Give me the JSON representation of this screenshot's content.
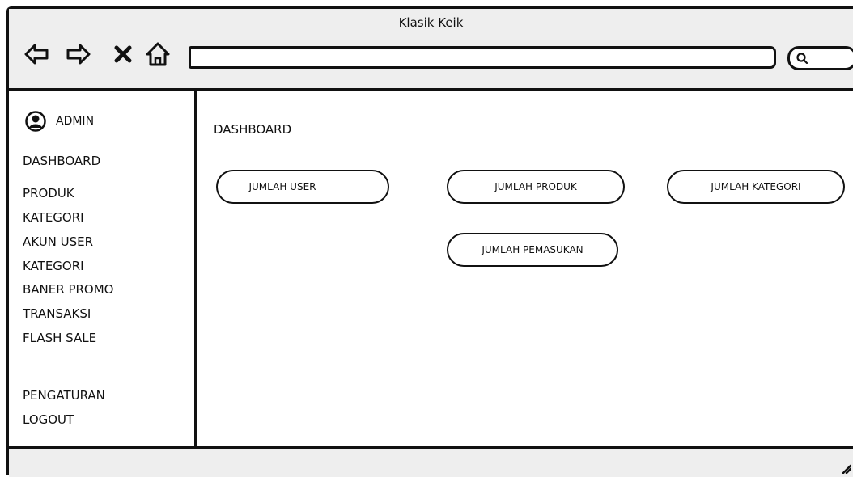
{
  "window": {
    "title": "Klasik Keik",
    "address_value": ""
  },
  "toolbar": {
    "icons": [
      "back-arrow-icon",
      "forward-arrow-icon",
      "close-x-icon",
      "home-icon",
      "search-icon"
    ]
  },
  "sidebar": {
    "admin_label": "ADMIN",
    "items": [
      {
        "label": "DASHBOARD"
      },
      {
        "label": "PRODUK"
      },
      {
        "label": "KATEGORI"
      },
      {
        "label": "AKUN USER"
      },
      {
        "label": "KATEGORI"
      },
      {
        "label": "BANER PROMO"
      },
      {
        "label": "TRANSAKSI"
      },
      {
        "label": "FLASH SALE"
      },
      {
        "label": "PENGATURAN"
      },
      {
        "label": "LOGOUT"
      }
    ]
  },
  "main": {
    "title": "DASHBOARD",
    "cards": [
      {
        "label": "JUMLAH USER"
      },
      {
        "label": "JUMLAH PRODUK"
      },
      {
        "label": "JUMLAH KATEGORI"
      },
      {
        "label": "JUMLAH PEMASUKAN"
      }
    ]
  },
  "colors": {
    "chrome": "#eeeeee",
    "stroke": "#111111",
    "background": "#ffffff"
  }
}
